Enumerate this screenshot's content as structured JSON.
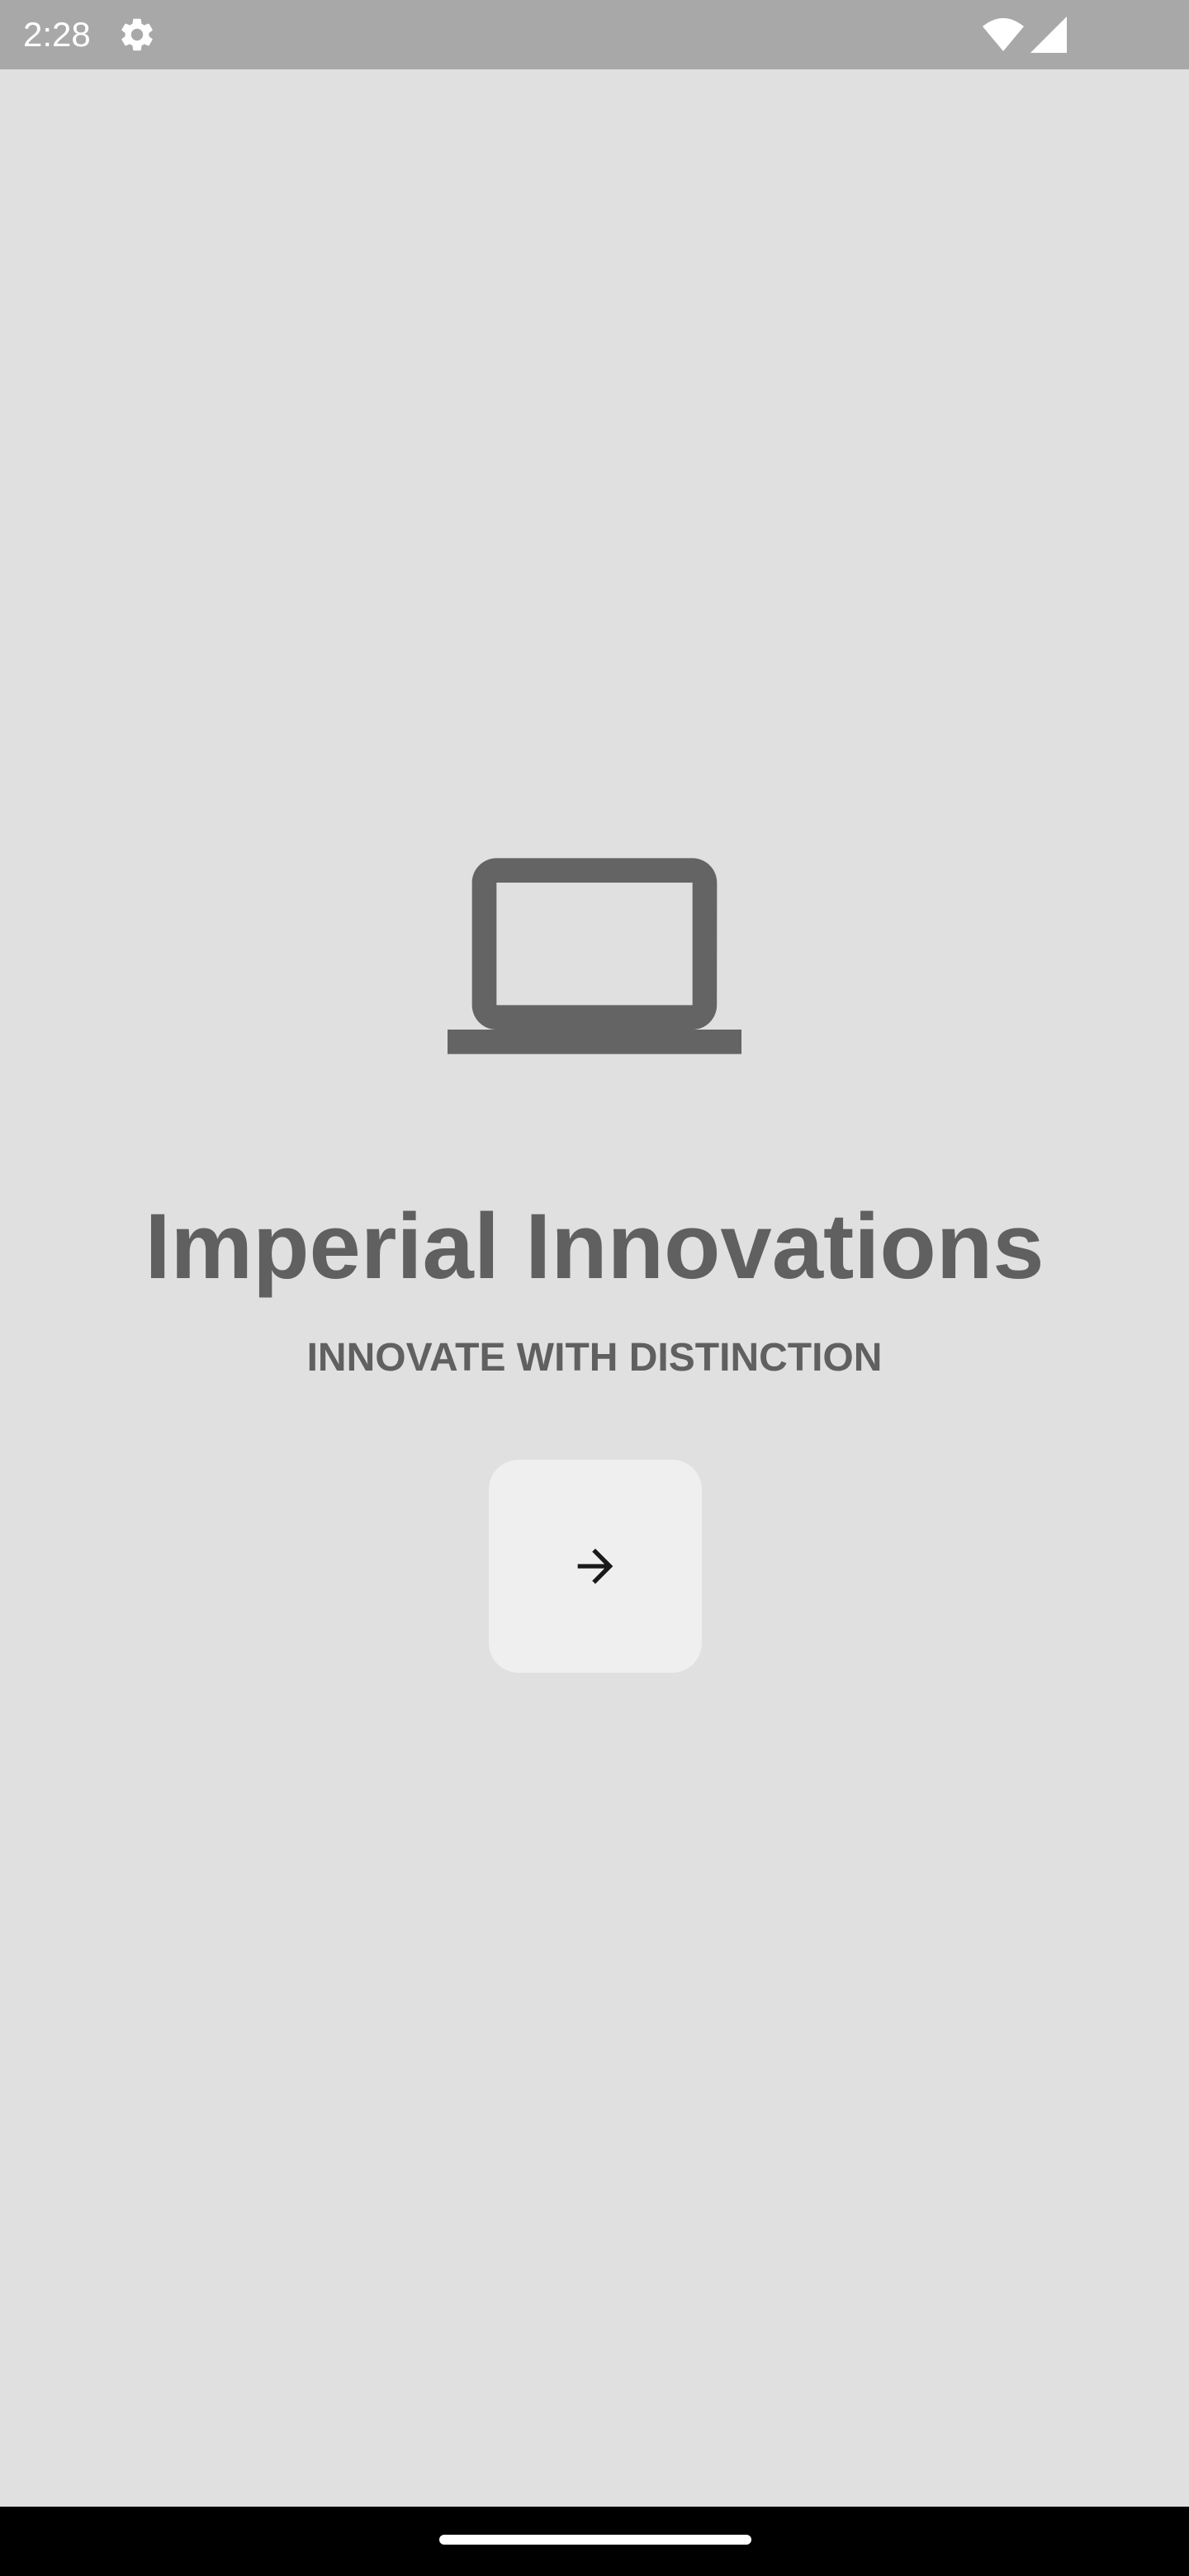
{
  "status_bar": {
    "time": "2:28",
    "icons": [
      "gear-icon",
      "wifi-icon",
      "signal-icon"
    ]
  },
  "splash": {
    "logo_icon": "laptop-icon",
    "title": "Imperial Innovations",
    "tagline": "INNOVATE WITH DISTINCTION",
    "next_button_icon": "arrow-right-icon"
  },
  "colors": {
    "background": "#e0e0e0",
    "status_bar": "#a8a8a8",
    "text": "#606060",
    "button": "#efefef",
    "nav_bar": "#000000"
  }
}
